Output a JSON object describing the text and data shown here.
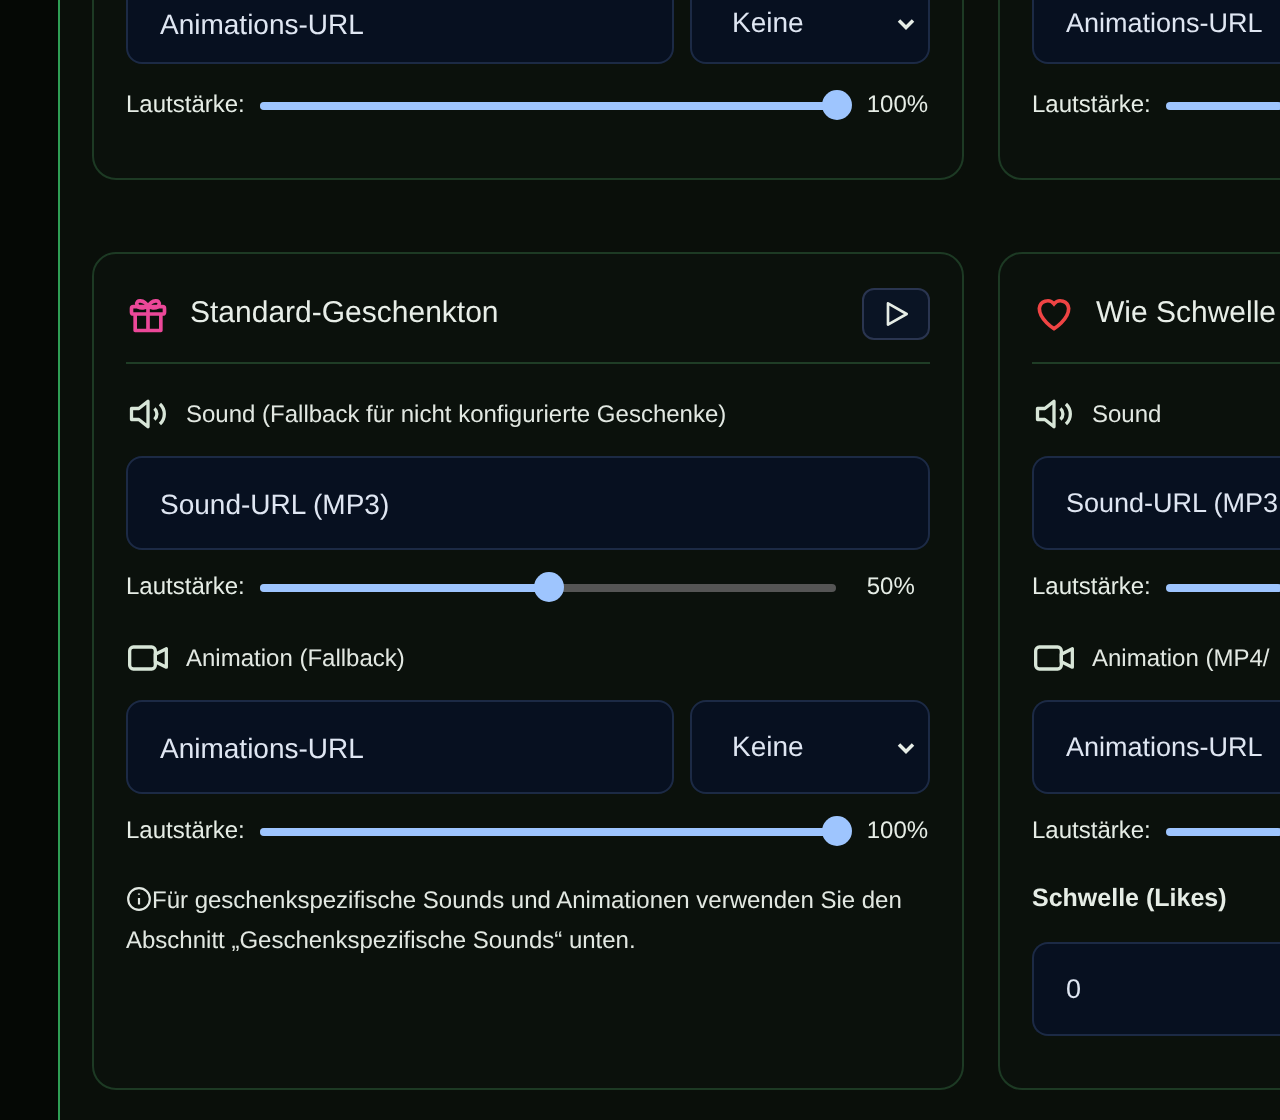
{
  "top_cards": [
    {
      "animation_field": {
        "placeholder": "Animations-URL"
      },
      "animation_select": {
        "value": "Keine"
      },
      "volume": {
        "label": "Lautstärke:",
        "level": 1,
        "reading": "100%"
      }
    },
    {
      "animation_field": {
        "placeholder": "Animations-URL"
      },
      "volume": {
        "label": "Lautstärke:"
      }
    }
  ],
  "cards": [
    {
      "kind": "gift",
      "title": "Standard-Geschenkton",
      "play_button": true,
      "sound_label": "Sound (Fallback für nicht konfigurierte Geschenke)",
      "sound_field": {
        "placeholder": "Sound-URL (MP3)"
      },
      "sound_volume": {
        "label": "Lautstärke:",
        "level": 0.5,
        "reading": "50%"
      },
      "animation_label": "Animation (Fallback)",
      "animation_field": {
        "placeholder": "Animations-URL"
      },
      "animation_select": {
        "value": "Keine"
      },
      "animation_volume": {
        "label": "Lautstärke:",
        "level": 1,
        "reading": "100%"
      },
      "note": "Für geschenkspezifische Sounds und Animationen verwenden Sie den Abschnitt „Geschenkspezifische Sounds“ unten."
    },
    {
      "kind": "heart",
      "title": "Wie Schwelle",
      "sound_label": "Sound",
      "sound_field": {
        "placeholder": "Sound-URL (MP3"
      },
      "sound_volume": {
        "label": "Lautstärke:"
      },
      "animation_label": "Animation (MP4/",
      "animation_field": {
        "placeholder": "Animations-URL"
      },
      "animation_volume": {
        "label": "Lautstärke:"
      },
      "threshold": {
        "label": "Schwelle (Likes)",
        "value": "0"
      }
    }
  ]
}
